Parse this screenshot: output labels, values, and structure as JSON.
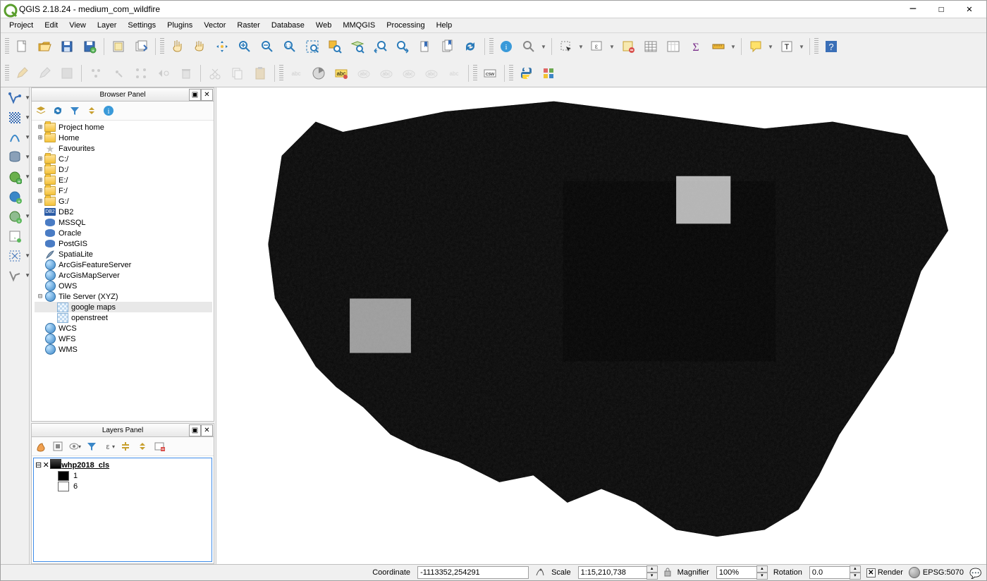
{
  "title": "QGIS 2.18.24 - medium_com_wildfire",
  "menu": [
    "Project",
    "Edit",
    "View",
    "Layer",
    "Settings",
    "Plugins",
    "Vector",
    "Raster",
    "Database",
    "Web",
    "MMQGIS",
    "Processing",
    "Help"
  ],
  "browserPanel": {
    "title": "Browser Panel",
    "items": [
      {
        "label": "Project home",
        "type": "folder",
        "exp": "+",
        "depth": 0
      },
      {
        "label": "Home",
        "type": "folder",
        "exp": "+",
        "depth": 0
      },
      {
        "label": "Favourites",
        "type": "star",
        "exp": "",
        "depth": 0
      },
      {
        "label": "C:/",
        "type": "drive",
        "exp": "+",
        "depth": 0
      },
      {
        "label": "D:/",
        "type": "drive",
        "exp": "+",
        "depth": 0
      },
      {
        "label": "E:/",
        "type": "drive",
        "exp": "+",
        "depth": 0
      },
      {
        "label": "F:/",
        "type": "drive",
        "exp": "+",
        "depth": 0
      },
      {
        "label": "G:/",
        "type": "drive",
        "exp": "+",
        "depth": 0
      },
      {
        "label": "DB2",
        "type": "db2",
        "exp": "",
        "depth": 0
      },
      {
        "label": "MSSQL",
        "type": "db",
        "exp": "",
        "depth": 0
      },
      {
        "label": "Oracle",
        "type": "db",
        "exp": "",
        "depth": 0
      },
      {
        "label": "PostGIS",
        "type": "db",
        "exp": "",
        "depth": 0
      },
      {
        "label": "SpatiaLite",
        "type": "feather",
        "exp": "",
        "depth": 0
      },
      {
        "label": "ArcGisFeatureServer",
        "type": "globe",
        "exp": "",
        "depth": 0
      },
      {
        "label": "ArcGisMapServer",
        "type": "globe",
        "exp": "",
        "depth": 0
      },
      {
        "label": "OWS",
        "type": "globe",
        "exp": "",
        "depth": 0
      },
      {
        "label": "Tile Server (XYZ)",
        "type": "globe",
        "exp": "-",
        "depth": 0
      },
      {
        "label": "google maps",
        "type": "tile",
        "exp": "",
        "depth": 1,
        "sel": true
      },
      {
        "label": "openstreet",
        "type": "tile",
        "exp": "",
        "depth": 1
      },
      {
        "label": "WCS",
        "type": "globe",
        "exp": "",
        "depth": 0
      },
      {
        "label": "WFS",
        "type": "globe",
        "exp": "",
        "depth": 0
      },
      {
        "label": "WMS",
        "type": "globe",
        "exp": "",
        "depth": 0
      }
    ]
  },
  "layersPanel": {
    "title": "Layers Panel",
    "layer": {
      "name": "whp2018_cls",
      "legend": [
        "1",
        "6"
      ]
    }
  },
  "status": {
    "coordinateLabel": "Coordinate",
    "coordinate": "-1113352,254291",
    "scaleLabel": "Scale",
    "scale": "1:15,210,738",
    "magnifierLabel": "Magnifier",
    "magnifier": "100%",
    "rotationLabel": "Rotation",
    "rotation": "0.0",
    "renderLabel": "Render",
    "crs": "EPSG:5070"
  }
}
